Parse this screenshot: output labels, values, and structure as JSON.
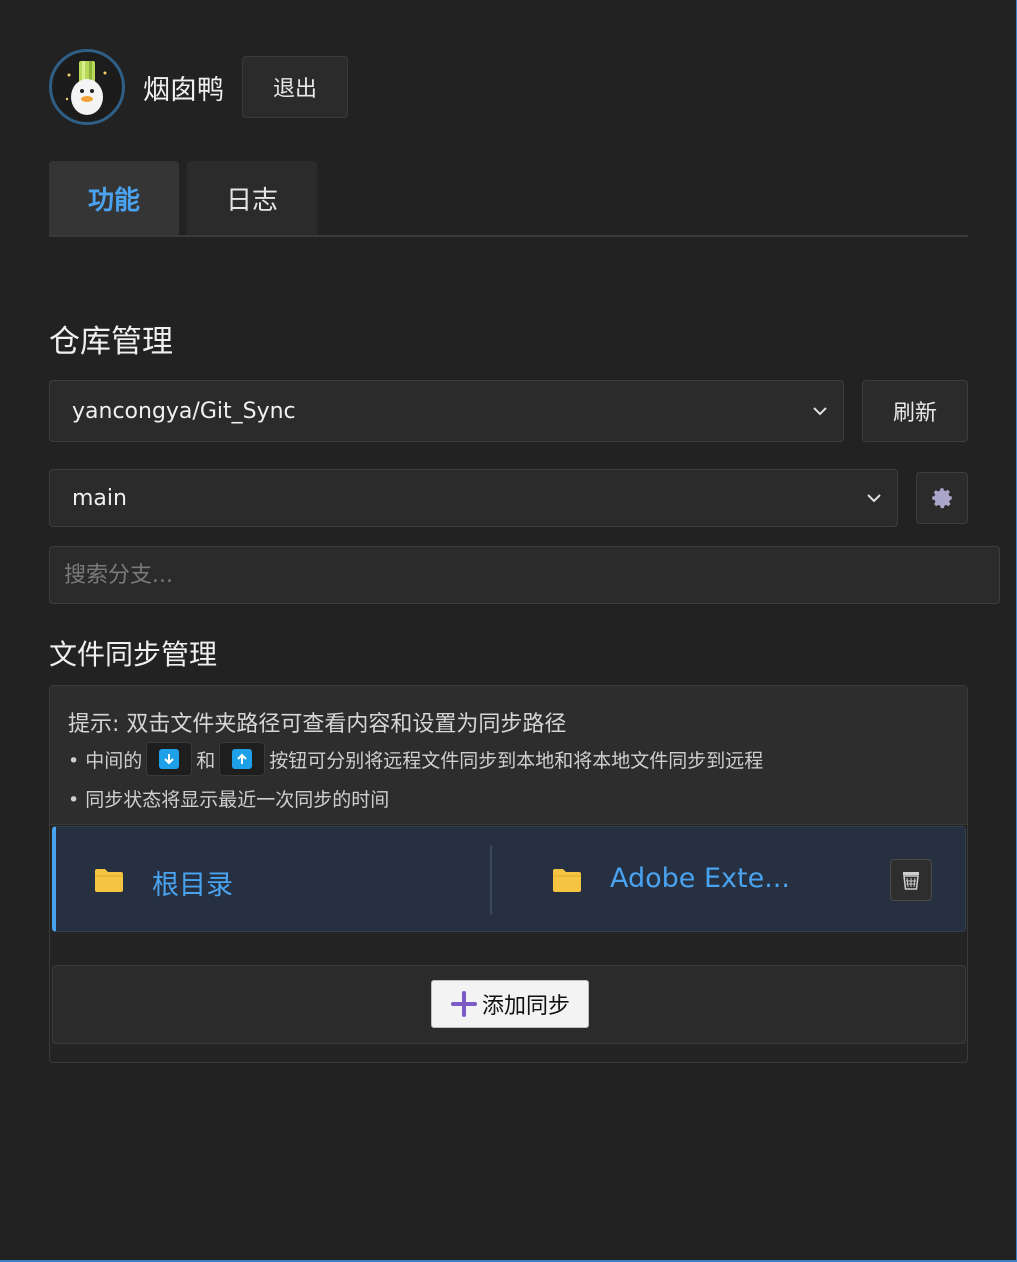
{
  "header": {
    "username": "烟囱鸭",
    "logout_label": "退出"
  },
  "tabs": [
    {
      "label": "功能",
      "active": true
    },
    {
      "label": "日志",
      "active": false
    }
  ],
  "repo_section": {
    "title": "仓库管理",
    "repo_select_value": "yancongya/Git_Sync",
    "refresh_label": "刷新",
    "branch_select_value": "main",
    "branch_search_placeholder": "搜索分支..."
  },
  "sync_section": {
    "title": "文件同步管理",
    "tip_head": "提示: 双击文件夹路径可查看内容和设置为同步路径",
    "tip_line1_a": "• 中间的",
    "tip_line1_b": "和",
    "tip_line1_c": "按钮可分别将远程文件同步到本地和将本地文件同步到远程",
    "tip_line2": "• 同步状态将显示最近一次同步的时间",
    "rows": [
      {
        "left_label": "根目录",
        "right_label": "Adobe Exte..."
      }
    ],
    "add_label": "添加同步"
  },
  "colors": {
    "accent": "#4aa3f0",
    "background": "#222222",
    "folder": "#f5c542",
    "add_icon": "#7b5cc4"
  }
}
